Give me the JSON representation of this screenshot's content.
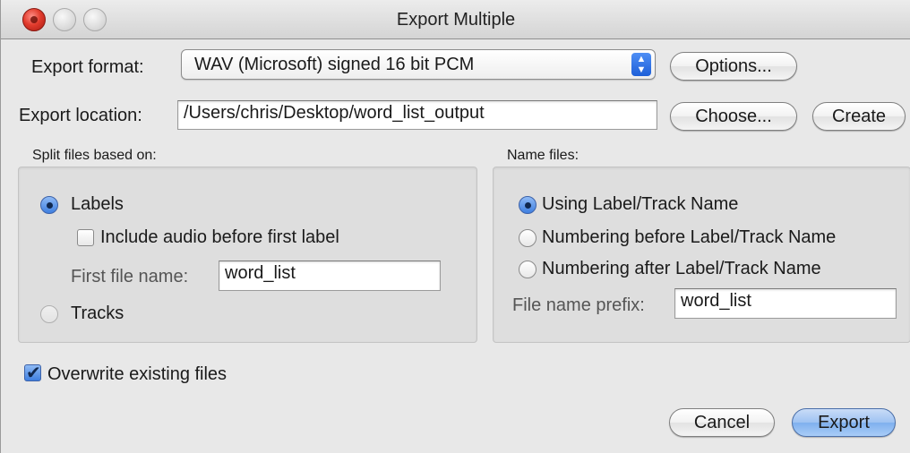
{
  "window": {
    "title": "Export Multiple"
  },
  "format": {
    "label": "Export format:",
    "selected": "WAV (Microsoft) signed 16 bit PCM",
    "options_button": "Options..."
  },
  "location": {
    "label": "Export location:",
    "value": "/Users/chris/Desktop/word_list_output",
    "choose_button": "Choose...",
    "create_button": "Create"
  },
  "split": {
    "heading": "Split files based on:",
    "labels_option": "Labels",
    "labels_selected": true,
    "include_audio_label": "Include audio before first label",
    "include_audio_checked": false,
    "first_file_name_label": "First file name:",
    "first_file_name_value": "word_list",
    "tracks_option": "Tracks"
  },
  "name_files": {
    "heading": "Name files:",
    "options": [
      "Using Label/Track Name",
      "Numbering before Label/Track Name",
      "Numbering after Label/Track Name"
    ],
    "selected_index": 0,
    "prefix_label": "File name prefix:",
    "prefix_value": "word_list"
  },
  "overwrite": {
    "label": "Overwrite existing files",
    "checked": true
  },
  "buttons": {
    "cancel": "Cancel",
    "export": "Export"
  },
  "icons": {
    "close": "close-button",
    "minimize": "minimize-button",
    "zoom": "zoom-button",
    "popup_stepper": "up-down-arrows-icon",
    "checkmark": "checkmark-icon"
  },
  "colors": {
    "accent": "#3f7fe0",
    "window_bg": "#e8e8e8",
    "group_bg": "#dedede"
  }
}
